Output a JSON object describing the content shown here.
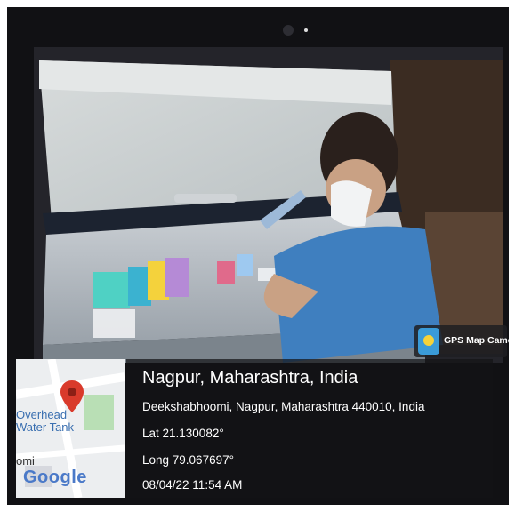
{
  "location": {
    "title": "Nagpur, Maharashtra, India",
    "address": "Deekshabhoomi, Nagpur, Maharashtra 440010, India",
    "lat": "Lat 21.130082°",
    "long": "Long 79.067697°",
    "datetime": "08/04/22 11:54 AM"
  },
  "map": {
    "label_overhead": "Overhead",
    "label_water": "Water Tank",
    "label_omi": "omi",
    "google": "Google",
    "pin_icon": "map-pin-icon",
    "pin_color": "#d93a2b"
  },
  "badge": {
    "text": "GPS Map Camera",
    "icon": "gps-camera-icon",
    "icon_color": "#3a9bd8"
  }
}
